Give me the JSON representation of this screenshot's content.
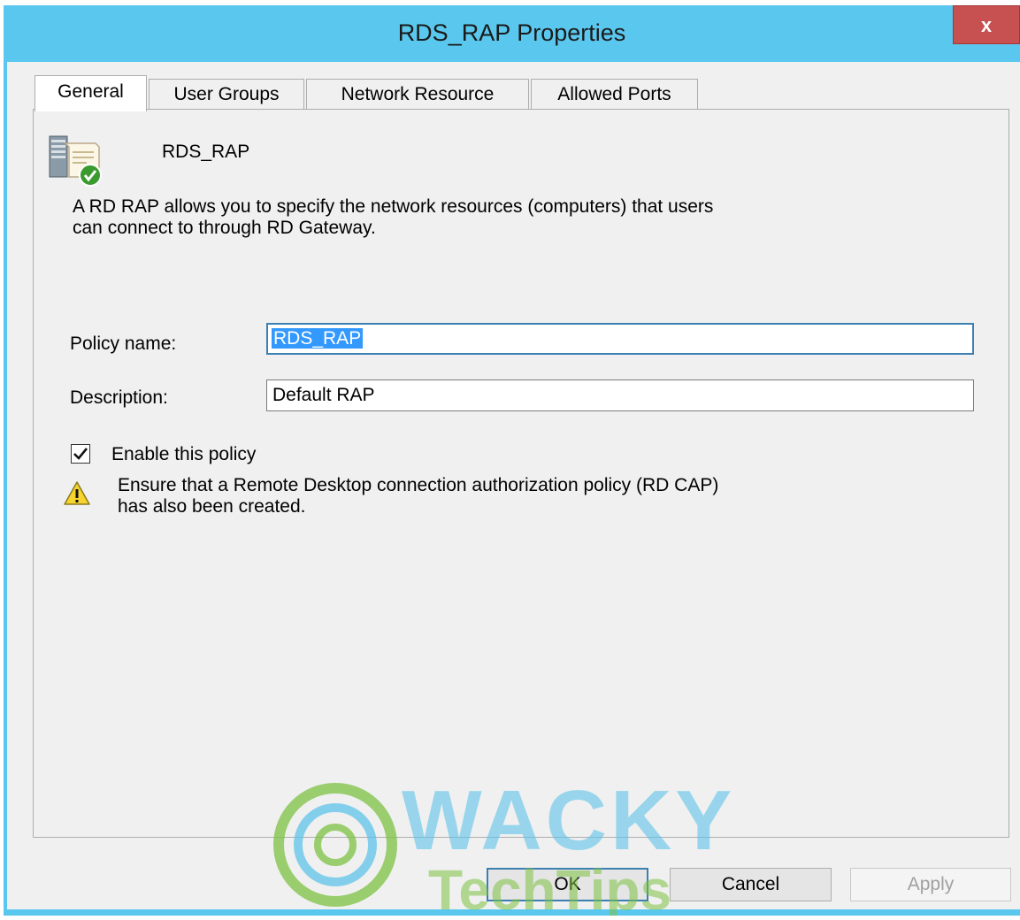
{
  "window": {
    "title": "RDS_RAP Properties",
    "close_label": "x"
  },
  "tabs": [
    {
      "label": "General",
      "active": true
    },
    {
      "label": "User Groups",
      "active": false
    },
    {
      "label": "Network Resource",
      "active": false
    },
    {
      "label": "Allowed Ports",
      "active": false
    }
  ],
  "general": {
    "policy_icon": "policy-server-icon",
    "policy_title": "RDS_RAP",
    "description_line1": "A RD RAP allows you to specify the network resources (computers) that users",
    "description_line2": "can connect to through RD Gateway.",
    "policy_name_label": "Policy name:",
    "policy_name_value": "RDS_RAP",
    "description_label": "Description:",
    "description_value": "Default RAP",
    "enable_label": "Enable this policy",
    "enable_checked": true,
    "warning_icon": "warning-icon",
    "warning_line1": "Ensure that a Remote Desktop connection authorization policy (RD CAP)",
    "warning_line2": "has also been created."
  },
  "buttons": {
    "ok": "OK",
    "cancel": "Cancel",
    "apply": "Apply",
    "apply_enabled": false
  },
  "watermark": {
    "line1": "WACKY",
    "line2": "TechTips"
  },
  "colors": {
    "titlebar": "#5ac8ee",
    "close": "#c75050",
    "selection": "#3399ff",
    "watermark_blue": "#5fc4ea",
    "watermark_green": "#7cc242"
  }
}
